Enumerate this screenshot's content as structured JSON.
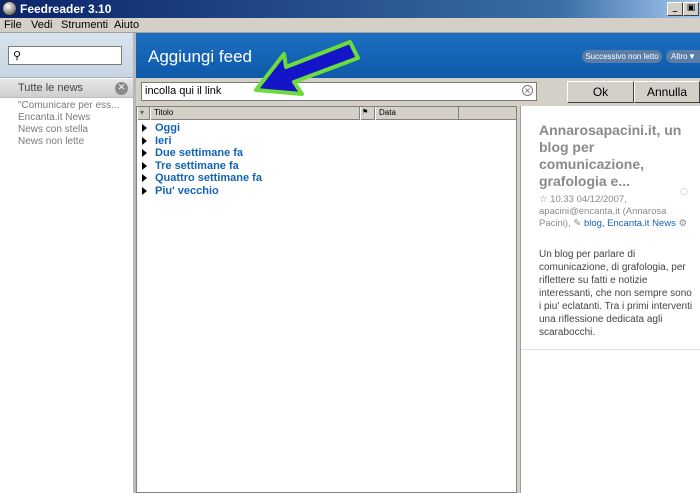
{
  "window": {
    "title": "Feedreader 3.10",
    "min_label": "_",
    "max_label": "▣"
  },
  "menu": {
    "items": [
      "File",
      "Vedi",
      "Strumenti",
      "Aiuto"
    ]
  },
  "sidebar": {
    "search_icon": "search-icon",
    "header": "Tutte le news",
    "items": [
      "\"Comunicare per ess...",
      "Encanta.it News",
      "News con stella",
      "News non lette"
    ]
  },
  "header": {
    "title": "Aggiungi feed",
    "next_unread": "Successivo non letto",
    "more": "Altro"
  },
  "add_feed": {
    "value": "incolla qui il link",
    "ok_label": "Ok",
    "cancel_label": "Annulla"
  },
  "list": {
    "columns": [
      "Titolo",
      "Data"
    ],
    "groups": [
      "Oggi",
      "Ieri",
      "Due settimane fa",
      "Tre settimane fa",
      "Quattro settimane fa",
      "Piu' vecchio"
    ]
  },
  "preview": {
    "title": "Annarosapacini.it, un blog per comunicazione, grafologia e...",
    "time": "10.33 04/12/2007,",
    "author": "apacini@encanta.it (Annarosa Pacini),",
    "tags": "blog, Encanta.it News",
    "body": "Un blog per parlare di comunicazione, di grafologia, per riflettere su fatti e notizie interessanti, che non sempre sono i piu' eclatanti. Tra i primi interventi una riflessione dedicata agli scarabocchi."
  },
  "colors": {
    "accent": "#1464b4",
    "header_blue": "#1565b8",
    "arrow_fill": "#1414c8",
    "arrow_stroke": "#6cdc3c"
  }
}
